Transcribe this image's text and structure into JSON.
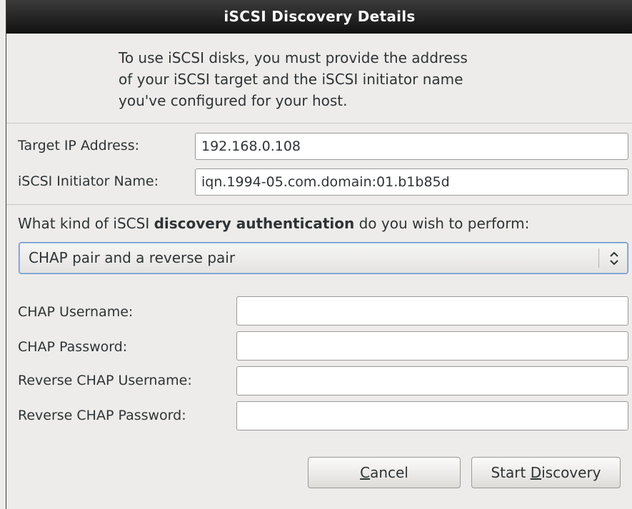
{
  "dialog": {
    "title": "iSCSI Discovery Details",
    "intro_lines": [
      "To use iSCSI disks, you must provide the address",
      "of your iSCSI target and the iSCSI initiator name",
      "you've configured for your host."
    ]
  },
  "target": {
    "label": "Target IP Address:",
    "value": "192.168.0.108"
  },
  "initiator": {
    "label": "iSCSI Initiator Name:",
    "value": "iqn.1994-05.com.domain:01.b1b85d"
  },
  "auth": {
    "question_prefix": "What kind of iSCSI ",
    "question_bold": "discovery authentication",
    "question_suffix": " do you wish to perform:",
    "selected": "CHAP pair and a reverse pair"
  },
  "chap": {
    "username_label": "CHAP Username:",
    "username_value": "",
    "password_label": "CHAP Password:",
    "password_value": "",
    "reverse_username_label": "Reverse CHAP Username:",
    "reverse_username_value": "",
    "reverse_password_label": "Reverse CHAP Password:",
    "reverse_password_value": ""
  },
  "buttons": {
    "cancel_mnemonic": "C",
    "cancel_rest": "ancel",
    "start_prefix": "Start ",
    "start_mnemonic": "D",
    "start_rest": "iscovery"
  }
}
